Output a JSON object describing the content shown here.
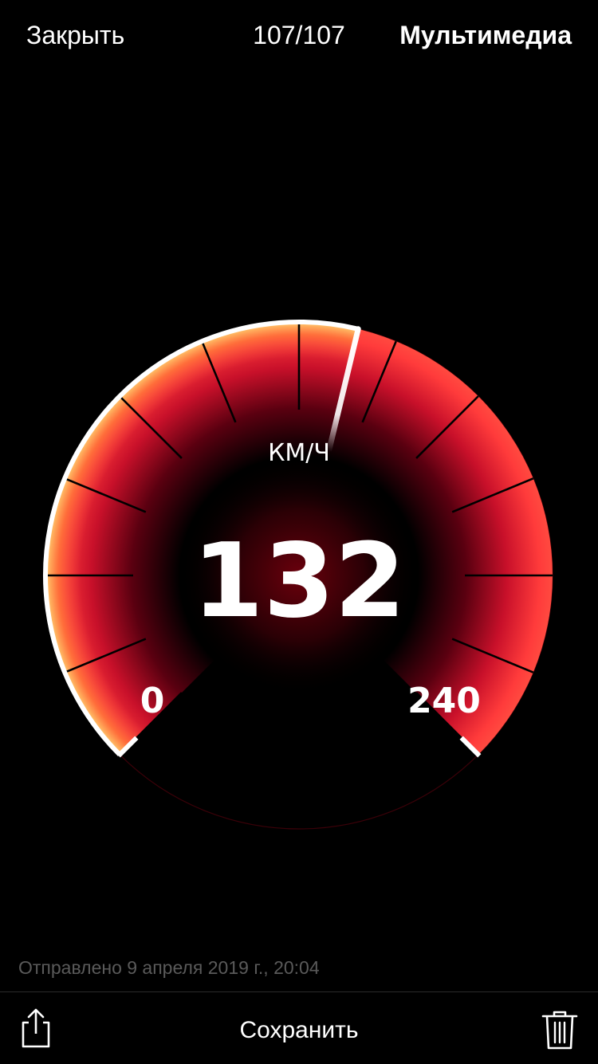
{
  "header": {
    "close_label": "Закрыть",
    "counter": "107/107",
    "media_label": "Мультимедиа"
  },
  "speedometer": {
    "unit": "КМ/Ч",
    "speed": "132",
    "min_label": "0",
    "max_label": "240",
    "min": 0,
    "max": 240,
    "value": 132,
    "colors": {
      "bright": "#ff3b3b",
      "mid": "#cc1122",
      "dark": "#2a0005",
      "glow": "#ff8a30",
      "needle": "#ffffff"
    }
  },
  "caption": "Отправлено 9 апреля 2019 г., 20:04",
  "toolbar": {
    "share_icon": "share-icon",
    "save_label": "Сохранить",
    "trash_icon": "trash-icon"
  }
}
